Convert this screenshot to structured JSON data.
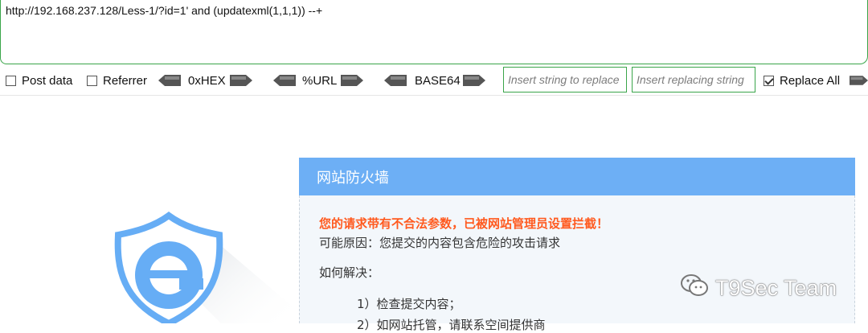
{
  "url_bar": {
    "value": "http://192.168.237.128/Less-1/?id=1' and (updatexml(1,1,1)) --+"
  },
  "toolbar": {
    "post_data": {
      "label": "Post data",
      "checked": false
    },
    "referrer": {
      "label": "Referrer",
      "checked": false
    },
    "hex_label": "0xHEX",
    "url_label": "%URL",
    "base64_label": "BASE64",
    "replace_from_placeholder": "Insert string to replace",
    "replace_to_placeholder": "Insert replacing string",
    "replace_all": {
      "label": "Replace All",
      "checked": true
    },
    "accent_color": "#3aa54a"
  },
  "firewall": {
    "title": "网站防火墙",
    "warning": "您的请求带有不合法参数，已被网站管理员设置拦截！",
    "reason": "可能原因：您提交的内容包含危险的攻击请求",
    "how_title": "如何解决：",
    "steps": [
      "1）检查提交内容；",
      "2）如网站托管，请联系空间提供商"
    ],
    "header_color": "#6daff5",
    "warning_color": "#ff5a1f"
  },
  "logo": {
    "icon": "shield-e-icon",
    "color": "#66adf5"
  },
  "watermark": {
    "text": "T9Sec Team",
    "icon": "wechat-icon"
  }
}
